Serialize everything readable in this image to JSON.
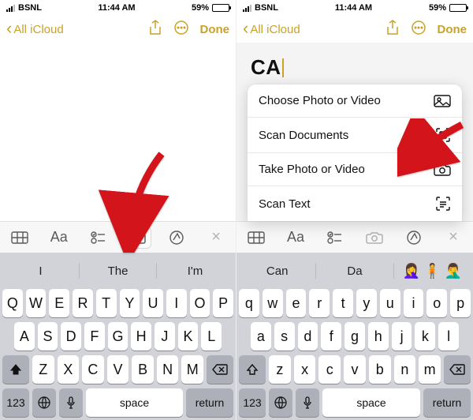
{
  "status": {
    "carrier": "BSNL",
    "time": "11:44 AM",
    "battery_pct": "59%",
    "battery_fill_pct": 59
  },
  "header": {
    "back_label": "All iCloud",
    "done_label": "Done"
  },
  "note_right_text": "CA",
  "menu": {
    "items": [
      "Choose Photo or Video",
      "Scan Documents",
      "Take Photo or Video",
      "Scan Text"
    ]
  },
  "toolbar": {
    "aa_label": "Aa"
  },
  "keyboard_left": {
    "suggestions": [
      "I",
      "The",
      "I'm"
    ],
    "row1": [
      "Q",
      "W",
      "E",
      "R",
      "T",
      "Y",
      "U",
      "I",
      "O",
      "P"
    ],
    "row2": [
      "A",
      "S",
      "D",
      "F",
      "G",
      "H",
      "J",
      "K",
      "L"
    ],
    "row3": [
      "Z",
      "X",
      "C",
      "V",
      "B",
      "N",
      "M"
    ],
    "k123": "123",
    "space": "space",
    "return": "return"
  },
  "keyboard_right": {
    "suggestions": [
      "Can",
      "Da"
    ],
    "emoji": [
      "🤦‍♀️",
      "🧍",
      "🤦‍♂️"
    ],
    "row1": [
      "q",
      "w",
      "e",
      "r",
      "t",
      "y",
      "u",
      "i",
      "o",
      "p"
    ],
    "row2": [
      "a",
      "s",
      "d",
      "f",
      "g",
      "h",
      "j",
      "k",
      "l"
    ],
    "row3": [
      "z",
      "x",
      "c",
      "v",
      "b",
      "n",
      "m"
    ],
    "k123": "123",
    "space": "space",
    "return": "return"
  }
}
